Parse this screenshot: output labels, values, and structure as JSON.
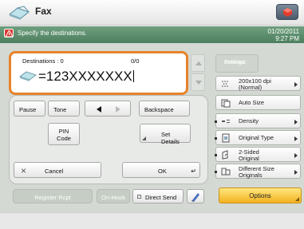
{
  "header": {
    "title": "Fax",
    "fax_icon": "fax-icon",
    "home_icon": "home-icon"
  },
  "status": {
    "message": "Specify the destinations.",
    "date": "01/20/2011",
    "time": "9:27 PM",
    "warning_color": "#d63a2f",
    "bar_color": "#5b8f6c"
  },
  "destination": {
    "count_label": "Destinations : 0",
    "entry_count": "0/0",
    "value": "=123XXXXXXX",
    "border_color": "#e8832a"
  },
  "keypad": {
    "pause": "Pause",
    "tone": "Tone",
    "backspace": "Backspace",
    "pin_line1": "PIN",
    "pin_line2": "Code",
    "set_details": "Set Details",
    "cancel": "Cancel",
    "ok": "OK"
  },
  "bottom": {
    "register_rcpt": "Register Rcpt",
    "on_hook": "On-Hook",
    "direct_send": "Direct Send",
    "options": "Options",
    "options_color": "#f3b21f"
  },
  "settings": {
    "previous_line1": "Previous",
    "previous_line2": "Settings",
    "resolution_line1": "200x100 dpi",
    "resolution_line2": "(Normal)",
    "auto_size": "Auto Size",
    "density": "Density",
    "original_type": "Original Type",
    "two_sided_line1": "2-Sided",
    "two_sided_line2": "Original",
    "diff_size_line1": "Different Size",
    "diff_size_line2": "Originals"
  }
}
